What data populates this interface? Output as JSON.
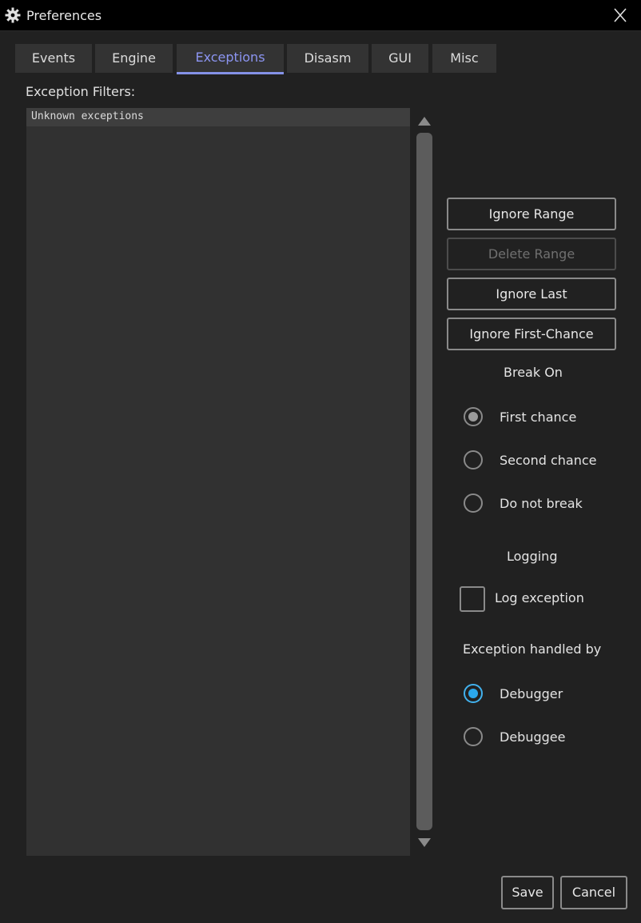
{
  "window": {
    "title": "Preferences",
    "icon": "gear-icon",
    "close_icon": "close-icon"
  },
  "tabs": [
    {
      "label": "Events",
      "active": false
    },
    {
      "label": "Engine",
      "active": false
    },
    {
      "label": "Exceptions",
      "active": true
    },
    {
      "label": "Disasm",
      "active": false
    },
    {
      "label": "GUI",
      "active": false
    },
    {
      "label": "Misc",
      "active": false
    }
  ],
  "filters": {
    "label": "Exception Filters:",
    "items": [
      "Unknown exceptions"
    ],
    "selected_index": 0
  },
  "actions": {
    "ignore_range": "Ignore Range",
    "delete_range": "Delete Range",
    "ignore_last": "Ignore Last",
    "ignore_first_chance": "Ignore First-Chance"
  },
  "break_on": {
    "label": "Break On",
    "options": [
      "First chance",
      "Second chance",
      "Do not break"
    ],
    "selected": "First chance"
  },
  "logging": {
    "label": "Logging",
    "log_exception_label": "Log exception",
    "log_exception_checked": false
  },
  "handled_by": {
    "label": "Exception handled by",
    "options": [
      "Debugger",
      "Debuggee"
    ],
    "selected": "Debugger"
  },
  "footer": {
    "save": "Save",
    "cancel": "Cancel"
  },
  "colors": {
    "background": "#212121",
    "active_tab": "#8c95f2",
    "radio_accent": "#2ba8ec",
    "disabled_text": "#707070"
  }
}
